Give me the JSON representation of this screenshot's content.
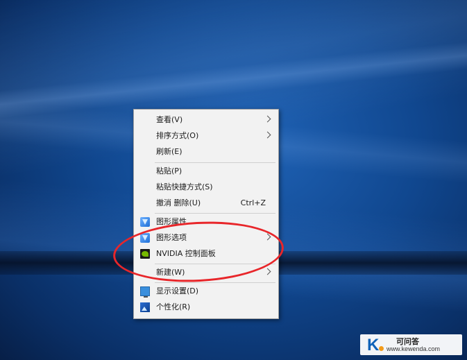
{
  "context_menu": {
    "items": [
      {
        "label": "查看(V)",
        "has_submenu": true
      },
      {
        "label": "排序方式(O)",
        "has_submenu": true
      },
      {
        "label": "刷新(E)"
      },
      {
        "label": "粘贴(P)"
      },
      {
        "label": "粘贴快捷方式(S)"
      },
      {
        "label": "撤消 删除(U)",
        "shortcut": "Ctrl+Z"
      },
      {
        "label": "图形属性...",
        "icon": "graphics-properties-icon"
      },
      {
        "label": "图形选项",
        "icon": "graphics-options-icon",
        "has_submenu": true
      },
      {
        "label": "NVIDIA 控制面板",
        "icon": "nvidia-icon"
      },
      {
        "label": "新建(W)",
        "has_submenu": true
      },
      {
        "label": "显示设置(D)",
        "icon": "display-settings-icon"
      },
      {
        "label": "个性化(R)",
        "icon": "personalize-icon"
      }
    ]
  },
  "annotation": {
    "color": "#e8262a",
    "shape": "hand-drawn-ellipse",
    "highlights": "NVIDIA 控制面板"
  },
  "watermark": {
    "brand": "可问答",
    "url": "www.kewenda.com",
    "logo_letter": "K"
  },
  "colors": {
    "desktop_blue": "#10478f",
    "menu_bg": "#f2f2f2",
    "annotation_red": "#e8262a"
  }
}
